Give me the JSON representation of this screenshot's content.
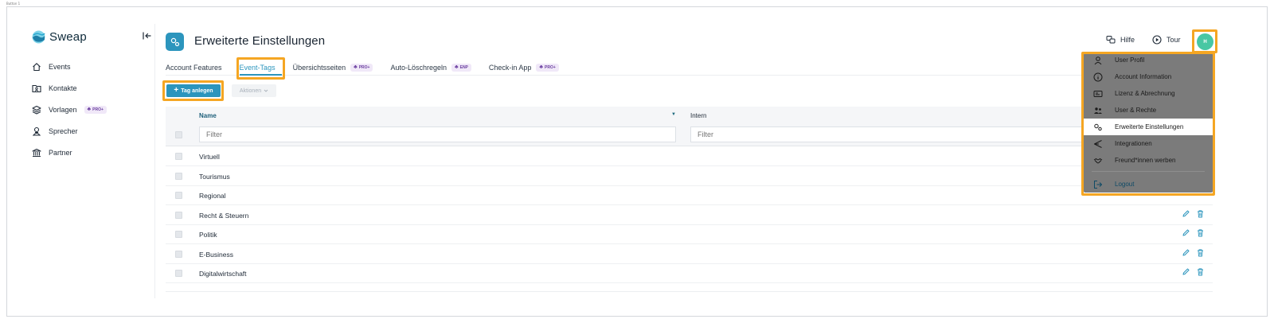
{
  "corner_label": "Button 1",
  "app": {
    "name": "Sweap"
  },
  "sidebar": {
    "collapse_icon": "collapse-left-icon",
    "items": [
      {
        "label": "Events",
        "icon": "home-icon"
      },
      {
        "label": "Kontakte",
        "icon": "contacts-folder-icon"
      },
      {
        "label": "Vorlagen",
        "icon": "layers-icon",
        "badge": "PRO+"
      },
      {
        "label": "Sprecher",
        "icon": "speaker-icon"
      },
      {
        "label": "Partner",
        "icon": "bank-icon"
      }
    ]
  },
  "header": {
    "title": "Erweiterte Einstellungen",
    "help_label": "Hilfe",
    "tour_label": "Tour",
    "avatar_initial": "H",
    "avatar_color": "#48c7a3"
  },
  "tabs": [
    {
      "label": "Account Features"
    },
    {
      "label": "Event-Tags",
      "active": true
    },
    {
      "label": "Übersichtsseiten",
      "badge": "PRO+"
    },
    {
      "label": "Auto-Löschregeln",
      "badge": "ENP"
    },
    {
      "label": "Check-in App",
      "badge": "PRO+"
    }
  ],
  "toolbar": {
    "add_label": "Tag anlegen",
    "actions_label": "Aktionen"
  },
  "table": {
    "columns": [
      "Name",
      "Intern"
    ],
    "filter_placeholder": "Filter",
    "rows": [
      {
        "name": "Virtuell"
      },
      {
        "name": "Tourismus"
      },
      {
        "name": "Regional"
      },
      {
        "name": "Recht & Steuern"
      },
      {
        "name": "Politik"
      },
      {
        "name": "E-Business"
      },
      {
        "name": "Digitalwirtschaft"
      }
    ]
  },
  "user_menu": {
    "items": [
      {
        "label": "User Profil",
        "icon": "user-icon"
      },
      {
        "label": "Account Information",
        "icon": "info-icon"
      },
      {
        "label": "Lizenz & Abrechnung",
        "icon": "license-card-icon"
      },
      {
        "label": "User & Rechte",
        "icon": "users-icon"
      },
      {
        "label": "Erweiterte Einstellungen",
        "icon": "settings-cogs-icon",
        "active": true
      },
      {
        "label": "Integrationen",
        "icon": "integration-icon"
      },
      {
        "label": "Freund*innen werben",
        "icon": "handshake-icon"
      },
      {
        "label": "Logout",
        "icon": "logout-icon"
      }
    ]
  },
  "colors": {
    "accent": "#2b95bd",
    "highlight": "#f5a623",
    "menu_overlay": "#7b7b7b",
    "badge_bg": "#f0e8f8",
    "badge_text": "#6b3fa0"
  }
}
